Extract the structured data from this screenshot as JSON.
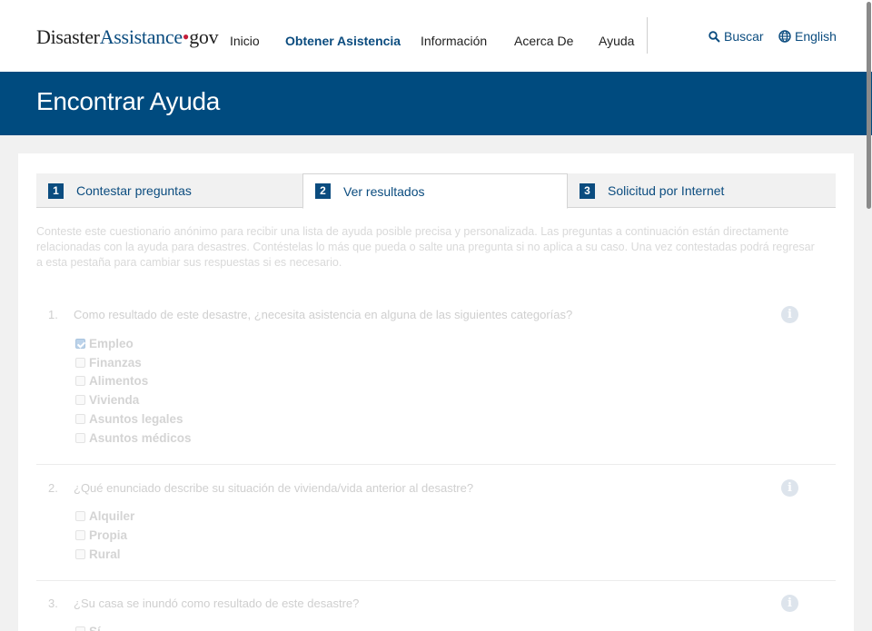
{
  "header": {
    "logo": {
      "part1": "Disaster",
      "part2": "Assistance",
      "dot": "•",
      "part3": "gov"
    },
    "nav": [
      {
        "label": "Inicio",
        "active": false
      },
      {
        "label": "Obtener Asistencia",
        "active": true
      },
      {
        "label": "Información",
        "active": false
      },
      {
        "label": "Acerca De",
        "active": false
      },
      {
        "label": "Ayuda",
        "active": false
      }
    ],
    "search_label": "Buscar",
    "search_icon": "search-icon",
    "language_label": "English",
    "language_icon": "globe-icon"
  },
  "banner": {
    "title": "Encontrar Ayuda"
  },
  "tabs": [
    {
      "num": "1",
      "label": "Contestar preguntas",
      "active": false
    },
    {
      "num": "2",
      "label": "Ver resultados",
      "active": true
    },
    {
      "num": "3",
      "label": "Solicitud por Internet",
      "active": false
    }
  ],
  "intro": "Conteste este cuestionario anónimo para recibir una lista de ayuda posible precisa y personalizada. Las preguntas a continuación están directamente relacionadas con la ayuda para desastres. Contéstelas lo más que pueda o salte una pregunta si no aplica a su caso. Una vez contestadas podrá regresar a esta pestaña para cambiar sus respuestas si es necesario.",
  "questions": [
    {
      "num": "1.",
      "text": "Como resultado de este desastre, ¿necesita asistencia en alguna de las siguientes categorías?",
      "options": [
        {
          "label": "Empleo",
          "checked": true
        },
        {
          "label": "Finanzas",
          "checked": false
        },
        {
          "label": "Alimentos",
          "checked": false
        },
        {
          "label": "Vivienda",
          "checked": false
        },
        {
          "label": "Asuntos legales",
          "checked": false
        },
        {
          "label": "Asuntos médicos",
          "checked": false
        }
      ]
    },
    {
      "num": "2.",
      "text": "¿Qué enunciado describe su situación de vivienda/vida anterior al desastre?",
      "options": [
        {
          "label": "Alquiler",
          "checked": false
        },
        {
          "label": "Propia",
          "checked": false
        },
        {
          "label": "Rural",
          "checked": false
        }
      ]
    },
    {
      "num": "3.",
      "text": "¿Su casa se inundó como resultado de este desastre?",
      "options": [
        {
          "label": "Sí",
          "checked": false
        }
      ]
    }
  ],
  "info_glyph": "i",
  "colors": {
    "brand": "#004b7f",
    "link": "#0b4c7f",
    "logo_dot": "#c41e3a"
  }
}
